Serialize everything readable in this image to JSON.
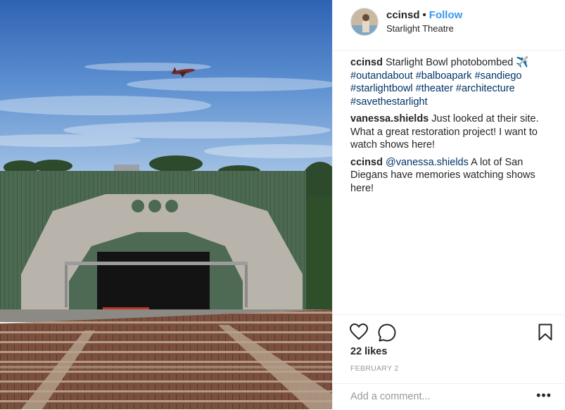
{
  "post": {
    "image_description_icon": "photo",
    "author": "ccinsd",
    "separator": "•",
    "follow_label": "Follow",
    "location": "Starlight Theatre"
  },
  "comments": [
    {
      "user": "ccinsd",
      "text": "Starlight Bowl photobombed ✈️",
      "hashtags": "#outandabout #balboapark #sandiego #starlightbowl #theater #architecture #savethestarlight"
    },
    {
      "user": "vanessa.shields",
      "text": "Just looked at their site. What a great restoration project! I want to watch shows here!"
    },
    {
      "user": "ccinsd",
      "mention": "@vanessa.shields",
      "text": "A lot of San Diegans have memories watching shows here!"
    }
  ],
  "actions": {
    "likes": "22 likes",
    "date": "FEBRUARY 2",
    "add_comment_placeholder": "Add a comment...",
    "more": "•••"
  },
  "colors": {
    "link": "#3897f0",
    "hashtag": "#003569"
  }
}
